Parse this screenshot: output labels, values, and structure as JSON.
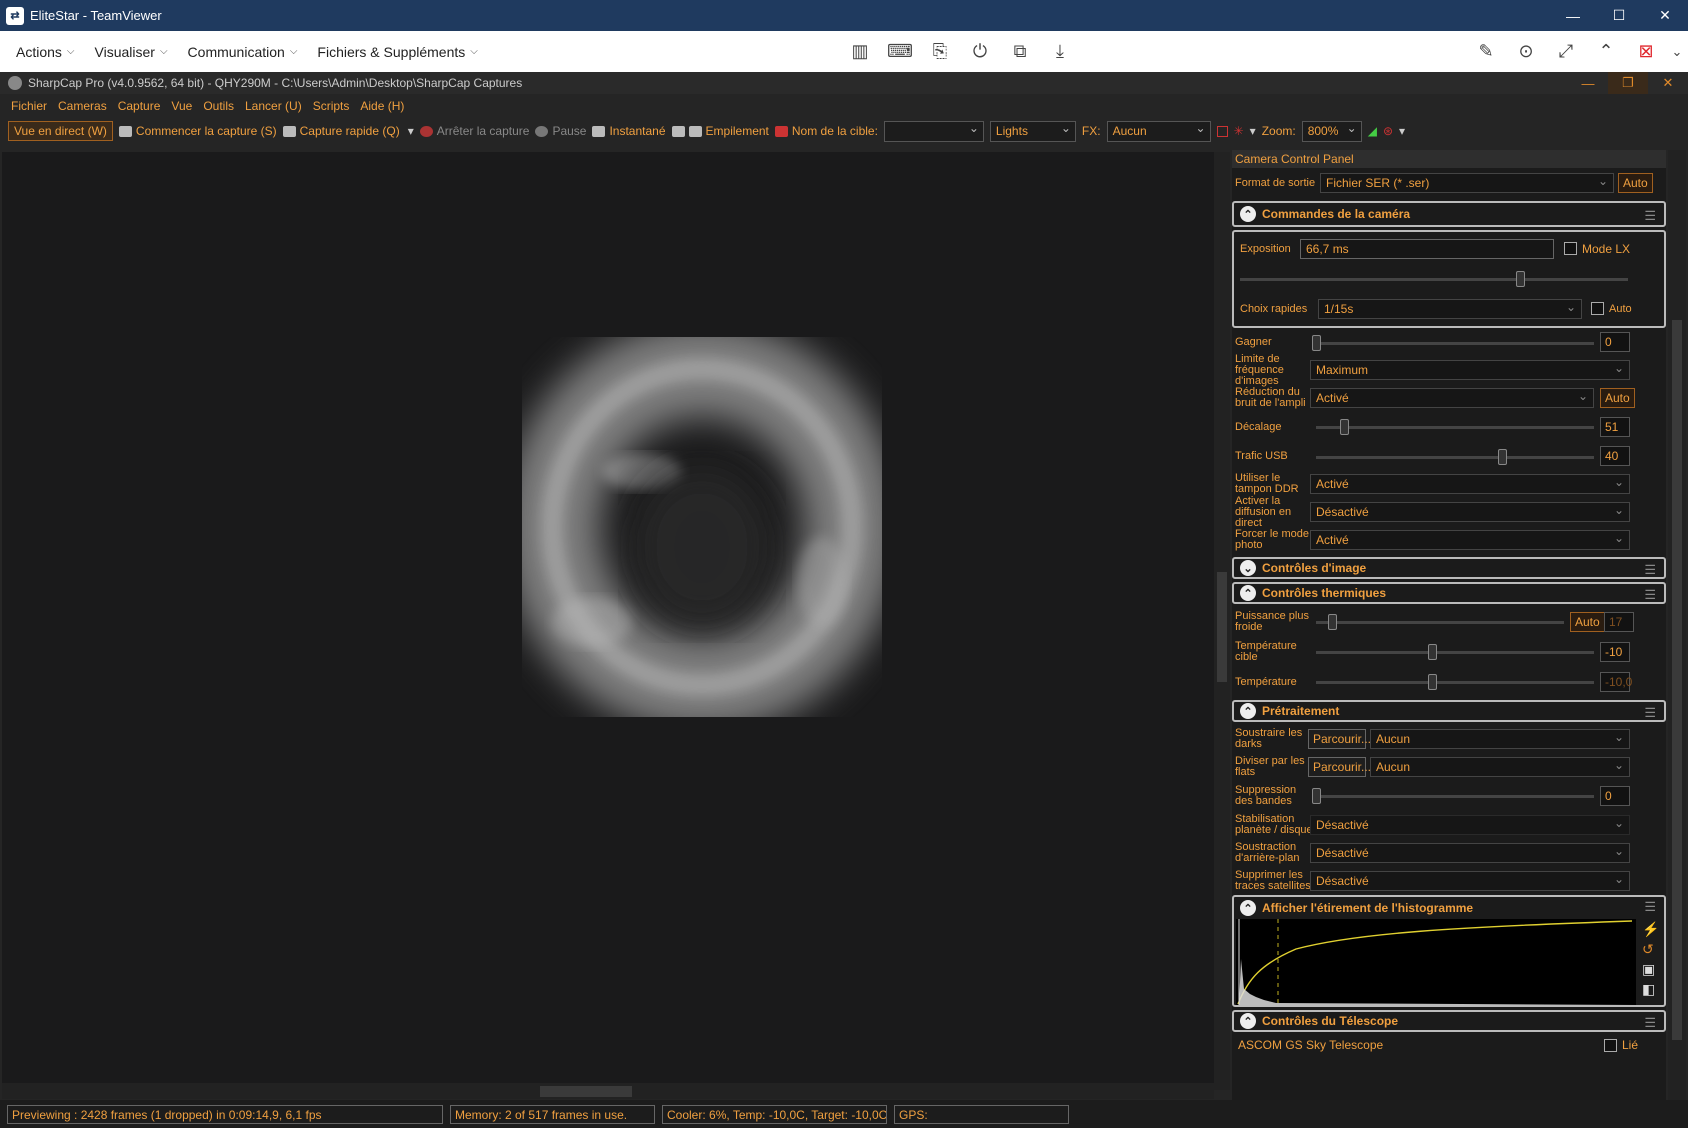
{
  "teamviewer": {
    "window_title": "EliteStar - TeamViewer",
    "menu": [
      "Actions",
      "Visualiser",
      "Communication",
      "Fichiers & Suppléments"
    ]
  },
  "sharpcap": {
    "window_title": "SharpCap Pro (v4.0.9562, 64 bit) - QHY290M - C:\\Users\\Admin\\Desktop\\SharpCap Captures",
    "menu": [
      "Fichier",
      "Cameras",
      "Capture",
      "Vue",
      "Outils",
      "Lancer (U)",
      "Scripts",
      "Aide (H)"
    ],
    "toolbar": {
      "live": "Vue en direct (W)",
      "start_capture": "Commencer la capture (S)",
      "quick_capture": "Capture rapide (Q)",
      "stop_capture": "Arrêter la capture",
      "pause": "Pause",
      "snapshot": "Instantané",
      "stacking": "Empilement",
      "target_label": "Nom de la cible:",
      "target_value": "",
      "frame_type": "Lights",
      "fx_label": "FX:",
      "fx_value": "Aucun",
      "zoom_label": "Zoom:",
      "zoom_value": "800%"
    }
  },
  "panel": {
    "title": "Camera Control Panel",
    "output_format_label": "Format de sortie",
    "output_format_value": "Fichier SER (* .ser)",
    "auto": "Auto",
    "camera_controls": {
      "title": "Commandes de la caméra",
      "exposure_label": "Exposition",
      "exposure_value": "66,7 ms",
      "lx_mode": "Mode LX",
      "quick_choices_label": "Choix rapides",
      "quick_choices_value": "1/15s",
      "quick_auto": "Auto",
      "gain_label": "Gagner",
      "gain_value": "0",
      "framerate_label": "Limite de fréquence d'images",
      "framerate_value": "Maximum",
      "ampnoise_label": "Réduction du bruit de l'ampli",
      "ampnoise_value": "Activé",
      "offset_label": "Décalage",
      "offset_value": "51",
      "usb_label": "Trafic USB",
      "usb_value": "40",
      "ddr_label": "Utiliser le tampon DDR",
      "ddr_value": "Activé",
      "stream_label": "Activer la diffusion en direct",
      "stream_value": "Désactivé",
      "photo_label": "Forcer le mode photo",
      "photo_value": "Activé"
    },
    "image_controls_title": "Contrôles d'image",
    "thermal": {
      "title": "Contrôles thermiques",
      "cooler_label": "Puissance plus froide",
      "cooler_value": "17",
      "target_label": "Température cible",
      "target_value": "-10",
      "temp_label": "Température",
      "temp_value": "-10,0"
    },
    "preprocessing": {
      "title": "Prétraitement",
      "darks_label": "Soustraire les darks",
      "flats_label": "Diviser par les flats",
      "browse": "Parcourir...",
      "none": "Aucun",
      "banding_label": "Suppression des bandes",
      "banding_value": "0",
      "stab_label": "Stabilisation planète / disque",
      "stab_value": "Désactivé",
      "bg_label": "Soustraction d'arrière-plan",
      "bg_value": "Désactivé",
      "sat_label": "Supprimer les traces satellites",
      "sat_value": "Désactivé"
    },
    "histogram_title": "Afficher l'étirement de l'histogramme",
    "telescope": {
      "title": "Contrôles du Télescope",
      "device": "ASCOM GS Sky Telescope",
      "linked": "Lié"
    }
  },
  "status": {
    "preview": "Previewing : 2428 frames (1 dropped) in 0:09:14,9, 6,1 fps",
    "memory": "Memory: 2 of 517 frames in use.",
    "cooler": "Cooler: 6%, Temp: -10,0C, Target: -10,0C",
    "gps": "GPS:"
  },
  "colors": {
    "accent": "#f0a040",
    "teamviewer_bar": "#1f3a5f"
  }
}
